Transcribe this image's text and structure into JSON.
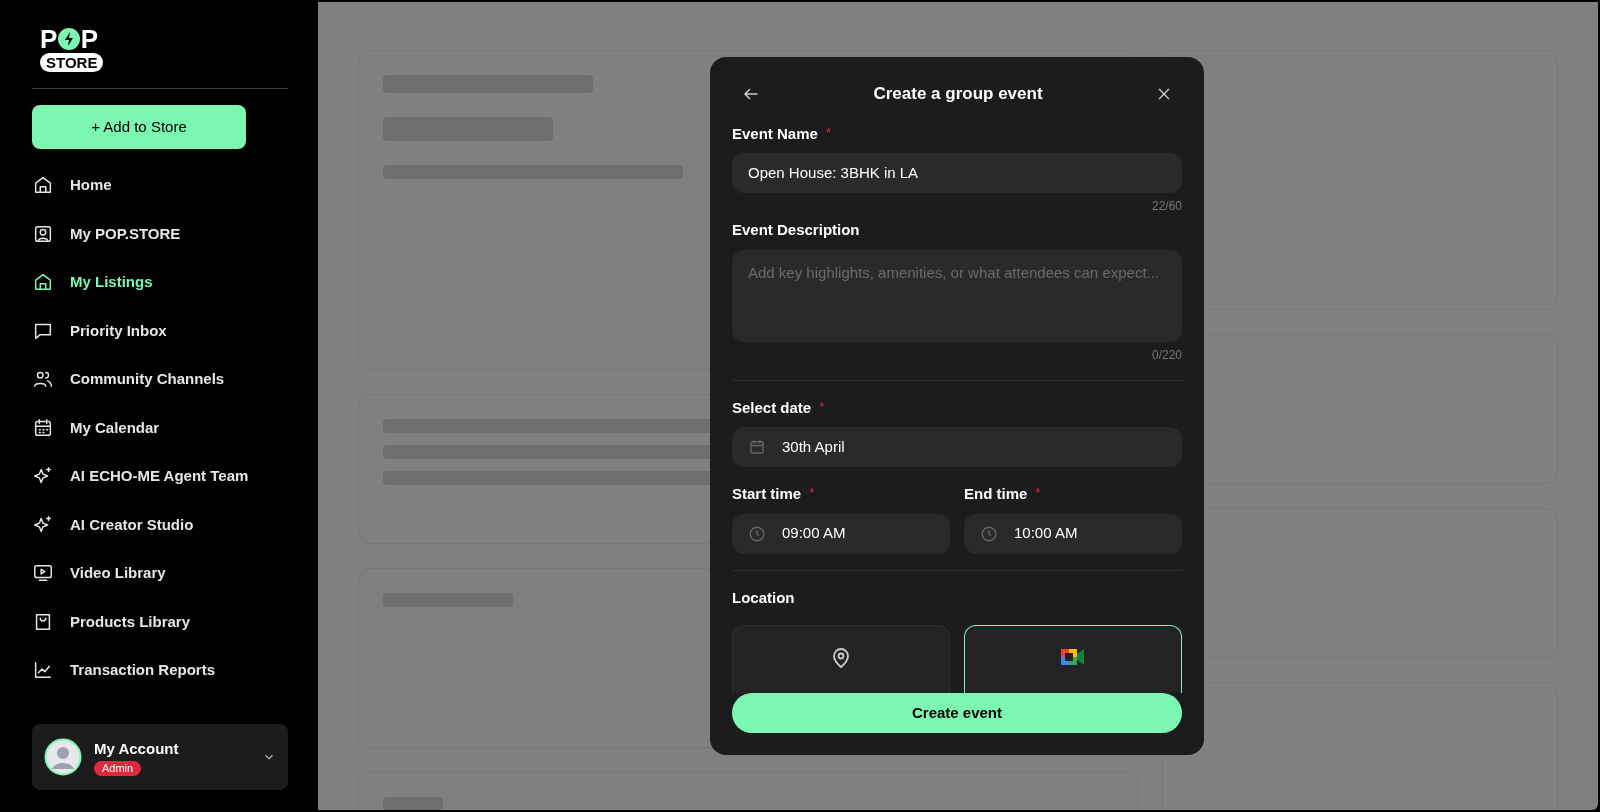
{
  "sidebar": {
    "logo": {
      "top": "P",
      "top2": "P",
      "bottom": "STORE"
    },
    "add_button": "+ Add to Store",
    "items": [
      {
        "label": "Home",
        "kind": "home",
        "selected": false
      },
      {
        "label": "My POP.STORE",
        "kind": "profile",
        "selected": false
      },
      {
        "label": "My Listings",
        "kind": "home",
        "selected": true
      },
      {
        "label": "Priority Inbox",
        "kind": "chat",
        "selected": false
      },
      {
        "label": "Community Channels",
        "kind": "users",
        "selected": false
      },
      {
        "label": "My Calendar",
        "kind": "calendar",
        "selected": false
      },
      {
        "label": "AI ECHO-ME Agent Team",
        "kind": "sparkle",
        "selected": false
      },
      {
        "label": "AI Creator Studio",
        "kind": "sparkle",
        "selected": false
      },
      {
        "label": "Video Library",
        "kind": "video",
        "selected": false
      },
      {
        "label": "Products Library",
        "kind": "bag",
        "selected": false
      },
      {
        "label": "Transaction Reports",
        "kind": "chart",
        "selected": false
      }
    ],
    "account": {
      "name": "My Account",
      "role": "Admin"
    }
  },
  "modal": {
    "title": "Create a group event",
    "event_name": {
      "label": "Event Name",
      "required_mark": "*",
      "value": "Open House: 3BHK in LA",
      "counter": "22/60"
    },
    "event_description": {
      "label": "Event Description",
      "placeholder": "Add key highlights, amenities, or what attendees can expect...",
      "counter": "0/220"
    },
    "date": {
      "label": "Select date",
      "required_mark": "*",
      "value": "30th April"
    },
    "start_time": {
      "label": "Start time",
      "required_mark": "*",
      "value": "09:00 AM"
    },
    "end_time": {
      "label": "End time",
      "required_mark": "*",
      "value": "10:00 AM"
    },
    "location": {
      "label": "Location",
      "options": [
        {
          "kind": "place",
          "selected": false
        },
        {
          "kind": "video",
          "selected": true
        }
      ]
    },
    "submit": "Create event"
  }
}
